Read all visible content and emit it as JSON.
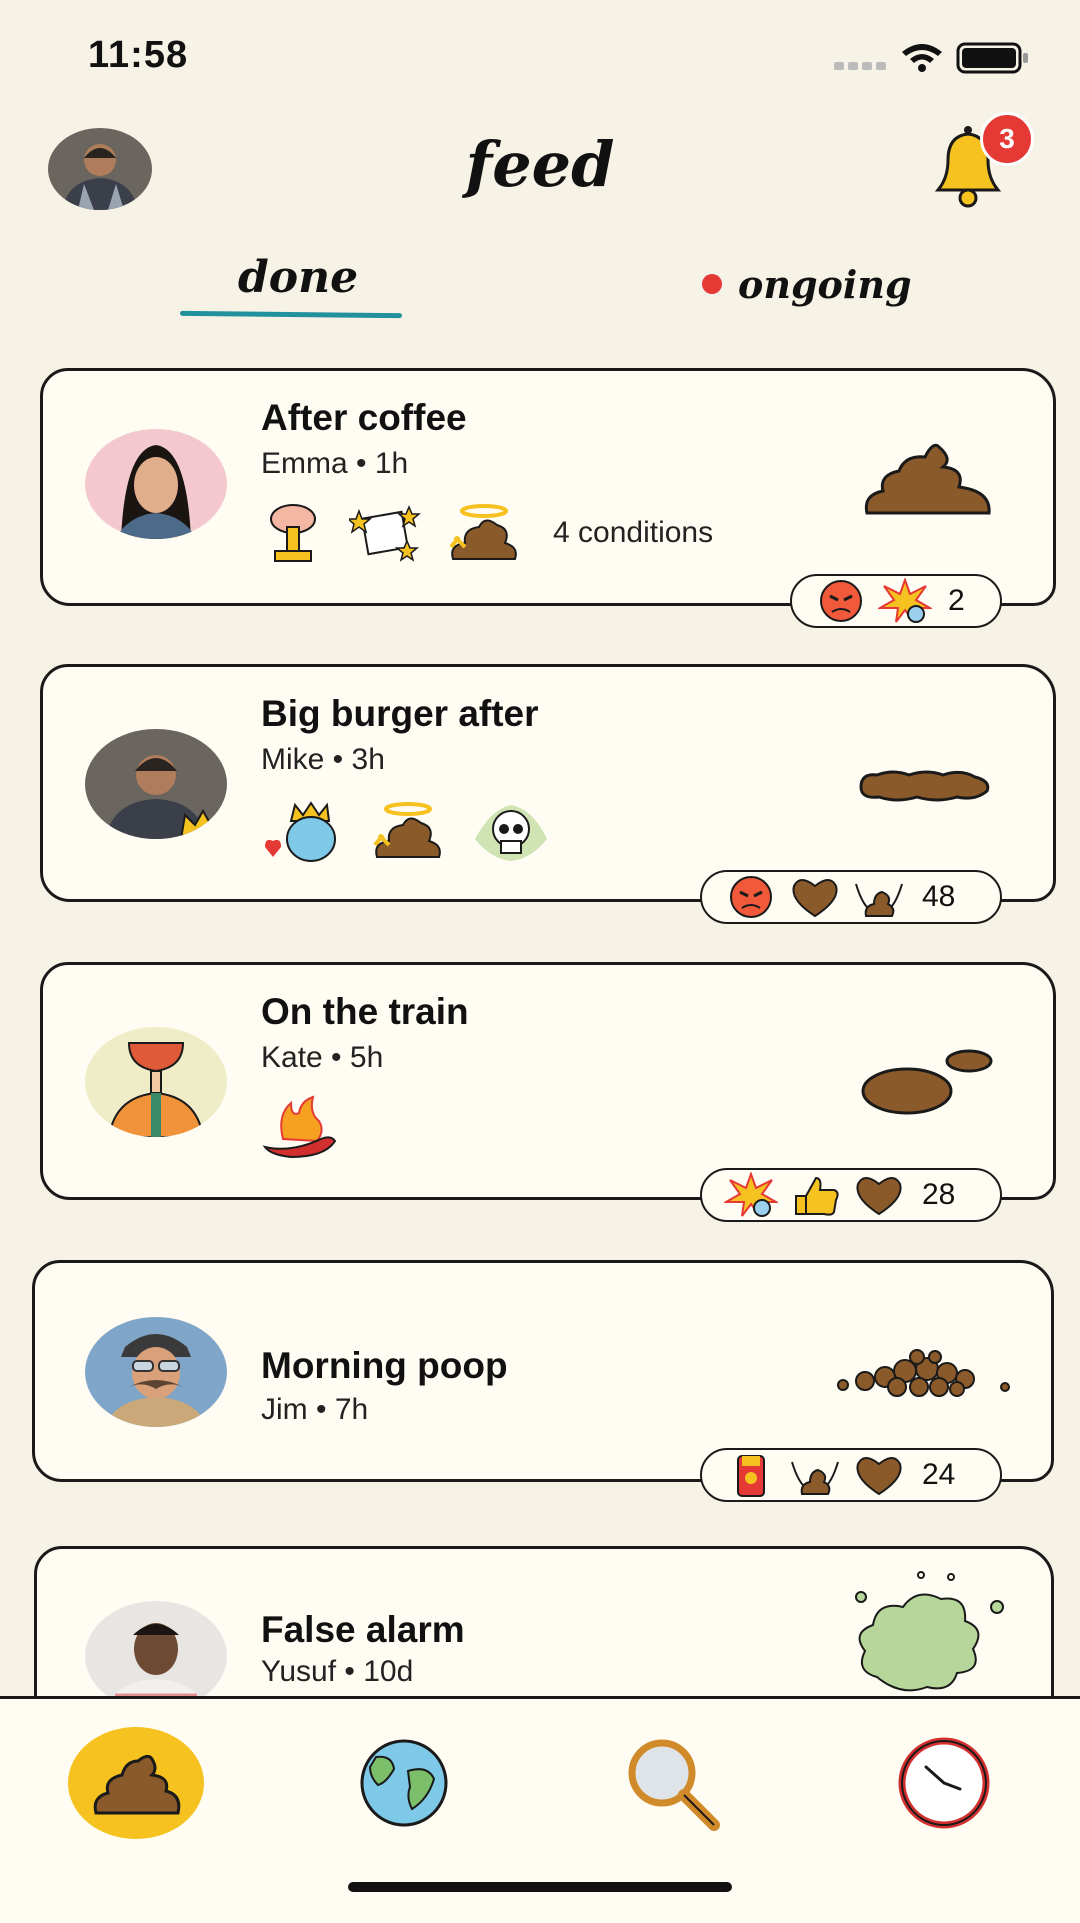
{
  "status_bar": {
    "time": "11:58"
  },
  "header": {
    "title": "feed",
    "notification_count": "3"
  },
  "tabs": [
    {
      "label": "done",
      "active": true
    },
    {
      "label": "ongoing",
      "active": false
    }
  ],
  "colors": {
    "accent_teal": "#21929c",
    "badge_red": "#e53935",
    "nav_active": "#f6c21f",
    "poop_brown": "#8b5a2b"
  },
  "feed": [
    {
      "title": "After coffee",
      "user": "Emma",
      "time": "1h",
      "conditions_label": "4 conditions",
      "stickers": [
        "explosion-sticker",
        "stars-sticker",
        "angel-poop-sticker"
      ],
      "reactions": [
        "angry-face",
        "punch"
      ],
      "reaction_count": "2"
    },
    {
      "title": "Big burger after",
      "user": "Mike",
      "time": "3h",
      "conditions_label": "",
      "stickers": [
        "crowned-blob-sticker",
        "angel-poop-sticker",
        "skull-sticker"
      ],
      "reactions": [
        "angry-face",
        "heart-poop",
        "winged-poop"
      ],
      "reaction_count": "48"
    },
    {
      "title": "On the train",
      "user": "Kate",
      "time": "5h",
      "conditions_label": "",
      "stickers": [
        "chili-fire-sticker"
      ],
      "reactions": [
        "punch",
        "thumbs-up",
        "heart-poop"
      ],
      "reaction_count": "28"
    },
    {
      "title": "Morning poop",
      "user": "Jim",
      "time": "7h",
      "conditions_label": "",
      "stickers": [],
      "reactions": [
        "superhero",
        "winged-poop",
        "heart-poop"
      ],
      "reaction_count": "24"
    },
    {
      "title": "False alarm",
      "user": "Yusuf",
      "time": "10d",
      "conditions_label": "",
      "stickers": [],
      "reactions": [],
      "reaction_count": ""
    }
  ],
  "nav": [
    {
      "name": "home",
      "icon": "poop-icon",
      "active": true
    },
    {
      "name": "world",
      "icon": "globe-icon",
      "active": false
    },
    {
      "name": "search",
      "icon": "magnifier-icon",
      "active": false
    },
    {
      "name": "history",
      "icon": "clock-icon",
      "active": false
    }
  ]
}
